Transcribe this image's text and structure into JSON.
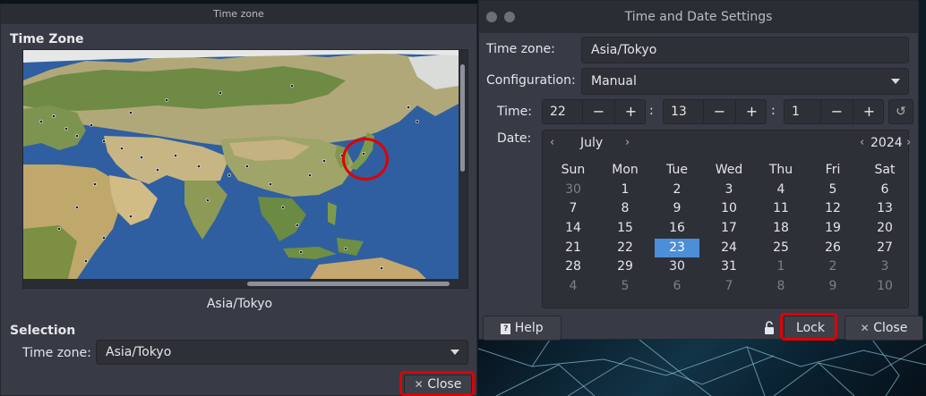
{
  "tz_window": {
    "title": "Time zone",
    "section_title": "Time Zone",
    "map_label": "Asia/Tokyo",
    "selection_title": "Selection",
    "timezone_label": "Time zone:",
    "timezone_value": "Asia/Tokyo",
    "close_label": "Close",
    "close_icon": "✕"
  },
  "td_window": {
    "title": "Time and Date Settings",
    "timezone_label": "Time zone:",
    "timezone_value": "Asia/Tokyo",
    "configuration_label": "Configuration:",
    "configuration_value": "Manual",
    "time_label": "Time:",
    "hour": "22",
    "minute": "13",
    "second": "1",
    "minus": "−",
    "plus": "+",
    "colon": ":",
    "date_label": "Date:",
    "month": "July",
    "year": "2024",
    "chev_left": "‹",
    "chev_right": "›",
    "weekdays": [
      "Sun",
      "Mon",
      "Tue",
      "Wed",
      "Thu",
      "Fri",
      "Sat"
    ],
    "days": [
      [
        "30",
        "1",
        "2",
        "3",
        "4",
        "5",
        "6"
      ],
      [
        "7",
        "8",
        "9",
        "10",
        "11",
        "12",
        "13"
      ],
      [
        "14",
        "15",
        "16",
        "17",
        "18",
        "19",
        "20"
      ],
      [
        "21",
        "22",
        "23",
        "24",
        "25",
        "26",
        "27"
      ],
      [
        "28",
        "29",
        "30",
        "31",
        "1",
        "2",
        "3"
      ],
      [
        "4",
        "5",
        "6",
        "7",
        "8",
        "9",
        "10"
      ]
    ],
    "selected_day": "23",
    "help_label": "Help",
    "help_icon": "?",
    "lock_label": "Lock",
    "close_label": "Close",
    "close_icon": "✕"
  },
  "colors": {
    "window_bg": "#383b46",
    "field_bg": "#2e3038",
    "selected_day": "#4a8fd8",
    "highlight": "#e00000",
    "ocean": "#2f5fa0"
  }
}
